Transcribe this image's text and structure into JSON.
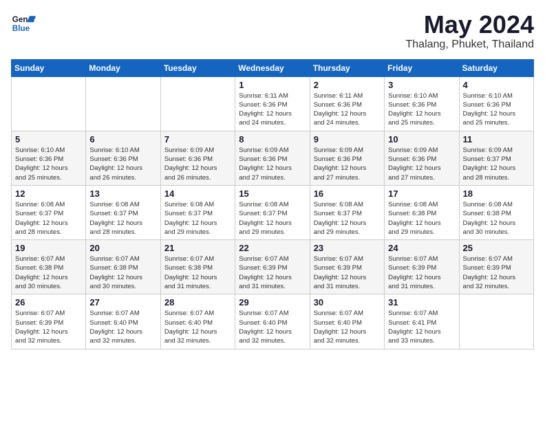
{
  "logo": {
    "line1": "General",
    "line2": "Blue"
  },
  "title": "May 2024",
  "location": "Thalang, Phuket, Thailand",
  "weekdays": [
    "Sunday",
    "Monday",
    "Tuesday",
    "Wednesday",
    "Thursday",
    "Friday",
    "Saturday"
  ],
  "weeks": [
    [
      {
        "day": "",
        "info": ""
      },
      {
        "day": "",
        "info": ""
      },
      {
        "day": "",
        "info": ""
      },
      {
        "day": "1",
        "info": "Sunrise: 6:11 AM\nSunset: 6:36 PM\nDaylight: 12 hours\nand 24 minutes."
      },
      {
        "day": "2",
        "info": "Sunrise: 6:11 AM\nSunset: 6:36 PM\nDaylight: 12 hours\nand 24 minutes."
      },
      {
        "day": "3",
        "info": "Sunrise: 6:10 AM\nSunset: 6:36 PM\nDaylight: 12 hours\nand 25 minutes."
      },
      {
        "day": "4",
        "info": "Sunrise: 6:10 AM\nSunset: 6:36 PM\nDaylight: 12 hours\nand 25 minutes."
      }
    ],
    [
      {
        "day": "5",
        "info": "Sunrise: 6:10 AM\nSunset: 6:36 PM\nDaylight: 12 hours\nand 25 minutes."
      },
      {
        "day": "6",
        "info": "Sunrise: 6:10 AM\nSunset: 6:36 PM\nDaylight: 12 hours\nand 26 minutes."
      },
      {
        "day": "7",
        "info": "Sunrise: 6:09 AM\nSunset: 6:36 PM\nDaylight: 12 hours\nand 26 minutes."
      },
      {
        "day": "8",
        "info": "Sunrise: 6:09 AM\nSunset: 6:36 PM\nDaylight: 12 hours\nand 27 minutes."
      },
      {
        "day": "9",
        "info": "Sunrise: 6:09 AM\nSunset: 6:36 PM\nDaylight: 12 hours\nand 27 minutes."
      },
      {
        "day": "10",
        "info": "Sunrise: 6:09 AM\nSunset: 6:36 PM\nDaylight: 12 hours\nand 27 minutes."
      },
      {
        "day": "11",
        "info": "Sunrise: 6:09 AM\nSunset: 6:37 PM\nDaylight: 12 hours\nand 28 minutes."
      }
    ],
    [
      {
        "day": "12",
        "info": "Sunrise: 6:08 AM\nSunset: 6:37 PM\nDaylight: 12 hours\nand 28 minutes."
      },
      {
        "day": "13",
        "info": "Sunrise: 6:08 AM\nSunset: 6:37 PM\nDaylight: 12 hours\nand 28 minutes."
      },
      {
        "day": "14",
        "info": "Sunrise: 6:08 AM\nSunset: 6:37 PM\nDaylight: 12 hours\nand 29 minutes."
      },
      {
        "day": "15",
        "info": "Sunrise: 6:08 AM\nSunset: 6:37 PM\nDaylight: 12 hours\nand 29 minutes."
      },
      {
        "day": "16",
        "info": "Sunrise: 6:08 AM\nSunset: 6:37 PM\nDaylight: 12 hours\nand 29 minutes."
      },
      {
        "day": "17",
        "info": "Sunrise: 6:08 AM\nSunset: 6:38 PM\nDaylight: 12 hours\nand 29 minutes."
      },
      {
        "day": "18",
        "info": "Sunrise: 6:08 AM\nSunset: 6:38 PM\nDaylight: 12 hours\nand 30 minutes."
      }
    ],
    [
      {
        "day": "19",
        "info": "Sunrise: 6:07 AM\nSunset: 6:38 PM\nDaylight: 12 hours\nand 30 minutes."
      },
      {
        "day": "20",
        "info": "Sunrise: 6:07 AM\nSunset: 6:38 PM\nDaylight: 12 hours\nand 30 minutes."
      },
      {
        "day": "21",
        "info": "Sunrise: 6:07 AM\nSunset: 6:38 PM\nDaylight: 12 hours\nand 31 minutes."
      },
      {
        "day": "22",
        "info": "Sunrise: 6:07 AM\nSunset: 6:39 PM\nDaylight: 12 hours\nand 31 minutes."
      },
      {
        "day": "23",
        "info": "Sunrise: 6:07 AM\nSunset: 6:39 PM\nDaylight: 12 hours\nand 31 minutes."
      },
      {
        "day": "24",
        "info": "Sunrise: 6:07 AM\nSunset: 6:39 PM\nDaylight: 12 hours\nand 31 minutes."
      },
      {
        "day": "25",
        "info": "Sunrise: 6:07 AM\nSunset: 6:39 PM\nDaylight: 12 hours\nand 32 minutes."
      }
    ],
    [
      {
        "day": "26",
        "info": "Sunrise: 6:07 AM\nSunset: 6:39 PM\nDaylight: 12 hours\nand 32 minutes."
      },
      {
        "day": "27",
        "info": "Sunrise: 6:07 AM\nSunset: 6:40 PM\nDaylight: 12 hours\nand 32 minutes."
      },
      {
        "day": "28",
        "info": "Sunrise: 6:07 AM\nSunset: 6:40 PM\nDaylight: 12 hours\nand 32 minutes."
      },
      {
        "day": "29",
        "info": "Sunrise: 6:07 AM\nSunset: 6:40 PM\nDaylight: 12 hours\nand 32 minutes."
      },
      {
        "day": "30",
        "info": "Sunrise: 6:07 AM\nSunset: 6:40 PM\nDaylight: 12 hours\nand 32 minutes."
      },
      {
        "day": "31",
        "info": "Sunrise: 6:07 AM\nSunset: 6:41 PM\nDaylight: 12 hours\nand 33 minutes."
      },
      {
        "day": "",
        "info": ""
      }
    ]
  ]
}
